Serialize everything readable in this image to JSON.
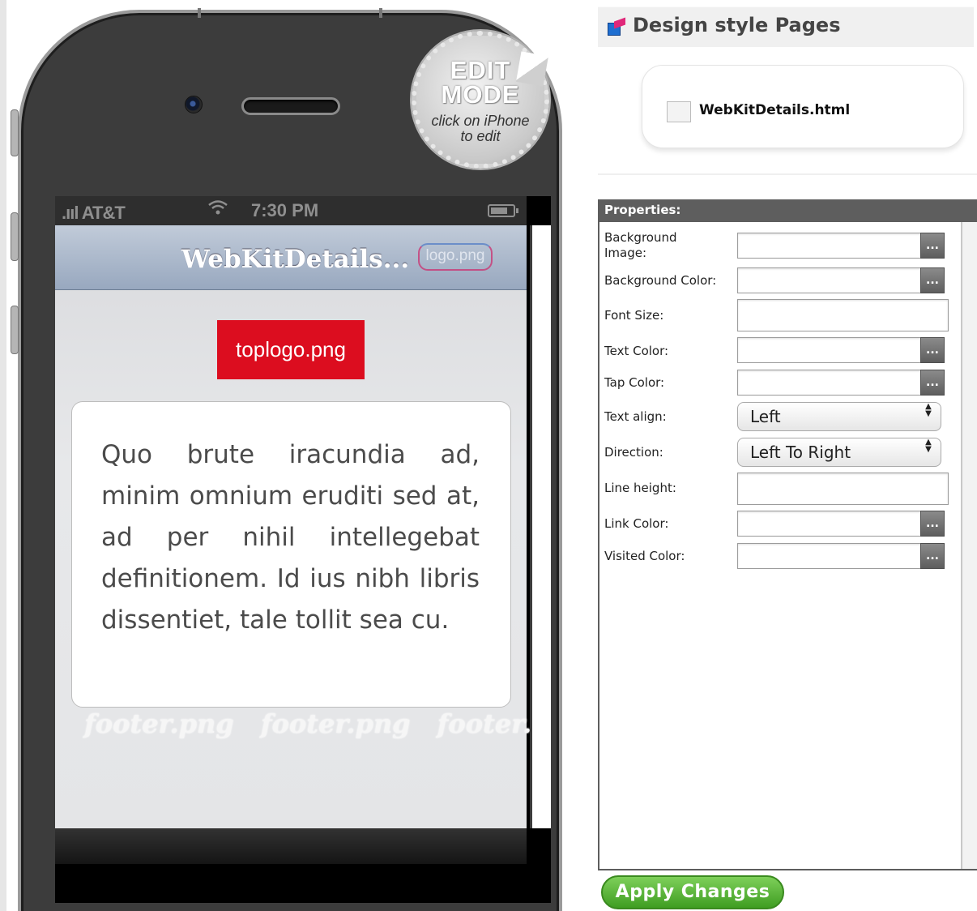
{
  "phone": {
    "status": {
      "carrier": ".ııl AT&T",
      "time": "7:30 PM"
    },
    "nav": {
      "title": "WebKitDetails...",
      "logo": "logo.png"
    },
    "toplogo": "toplogo.png",
    "content": "Quo brute iracundia ad, minim omnium eruditi sed at, ad per nihil intellegebat definitionem. Id ius nibh libris dissentiet, tale tollit sea cu.",
    "footer": [
      "footer.png",
      "footer.png",
      "footer.png"
    ]
  },
  "edit_badge": {
    "title_line1": "EDIT",
    "title_line2": "MODE",
    "subtitle_line1": "click on iPhone",
    "subtitle_line2": "to edit"
  },
  "panel": {
    "title": "Design style Pages",
    "pages": [
      {
        "name": "WebKitDetails.html",
        "checked": false
      }
    ]
  },
  "properties": {
    "header": "Properties:",
    "picker_label": "...",
    "fields": {
      "background_image": {
        "label_line1": "Background",
        "label_line2": "Image:",
        "value": ""
      },
      "background_color": {
        "label": "Background Color:",
        "value": ""
      },
      "font_size": {
        "label": "Font Size:",
        "value": ""
      },
      "text_color": {
        "label": "Text Color:",
        "value": ""
      },
      "tap_color": {
        "label": "Tap Color:",
        "value": ""
      },
      "text_align": {
        "label": "Text align:",
        "value": "Left"
      },
      "direction": {
        "label": "Direction:",
        "value": "Left To Right"
      },
      "line_height": {
        "label": "Line height:",
        "value": ""
      },
      "link_color": {
        "label": "Link Color:",
        "value": ""
      },
      "visited_color": {
        "label": "Visited Color:",
        "value": ""
      }
    }
  },
  "apply_button": "Apply Changes",
  "colors": {
    "toplogo_bg": "#dc0d1f",
    "apply_green": "#4caf2e",
    "props_header": "#5e5e5e"
  },
  "icons": [
    "wifi-icon",
    "battery-icon",
    "pages-icon",
    "select-arrows-icon"
  ]
}
